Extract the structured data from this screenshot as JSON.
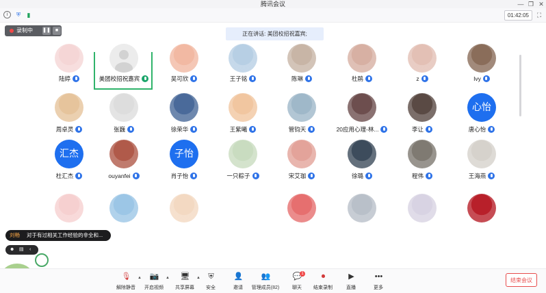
{
  "window": {
    "title": "腾讯会议",
    "minimize_glyph": "—",
    "restore_glyph": "❐",
    "close_glyph": "✕"
  },
  "topbar": {
    "timer": "01:42:05"
  },
  "recording": {
    "label": "录制中",
    "pause_glyph": "❚❚",
    "stop_glyph": "■"
  },
  "speaking": {
    "text": "正在讲话: 美团校招祝嘉宾;"
  },
  "participants": [
    {
      "name": "陆婷",
      "avatar": "photo",
      "color": "#f5d6d6",
      "mic": "blue"
    },
    {
      "name": "美团校招祝嘉宾",
      "avatar": "default",
      "color": "#eeeeee",
      "mic": "green"
    },
    {
      "name": "吴可欣",
      "avatar": "photo",
      "color": "#f2b9a3",
      "mic": "blue"
    },
    {
      "name": "王子铭",
      "avatar": "photo",
      "color": "#b7cfe4",
      "mic": "blue"
    },
    {
      "name": "陈琳",
      "avatar": "photo",
      "color": "#c8b5a6",
      "mic": "blue"
    },
    {
      "name": "杜鹃",
      "avatar": "photo",
      "color": "#d7b0a3",
      "mic": "blue"
    },
    {
      "name": "z",
      "avatar": "photo",
      "color": "#e3c0b5",
      "mic": "blue"
    },
    {
      "name": "Ivy",
      "avatar": "photo",
      "color": "#8a6d5a",
      "mic": "blue"
    },
    {
      "name": "周卓灵",
      "avatar": "photo",
      "color": "#e6c49c",
      "mic": "blue"
    },
    {
      "name": "张巍",
      "avatar": "photo",
      "color": "#dddddd",
      "mic": "blue"
    },
    {
      "name": "徐荣华",
      "avatar": "photo",
      "color": "#4a6a9a",
      "mic": "blue"
    },
    {
      "name": "王紫曦",
      "avatar": "photo",
      "color": "#f1c6a0",
      "mic": "blue"
    },
    {
      "name": "管钧天",
      "avatar": "photo",
      "color": "#9fb8c9",
      "mic": "blue"
    },
    {
      "name": "20应用心理-林...",
      "avatar": "photo",
      "color": "#6d4e4e",
      "mic": "blue"
    },
    {
      "name": "李让",
      "avatar": "photo",
      "color": "#5a4a44",
      "mic": "blue"
    },
    {
      "name": "唐心怡",
      "avatar": "text",
      "text": "心怡",
      "mic": "blue"
    },
    {
      "name": "杜汇杰",
      "avatar": "text",
      "text": "汇杰",
      "mic": "blue"
    },
    {
      "name": "ouyanfei",
      "avatar": "photo",
      "color": "#b05a4a",
      "mic": "blue"
    },
    {
      "name": "肖子怡",
      "avatar": "text",
      "text": "子怡",
      "mic": "blue"
    },
    {
      "name": "一只粽子",
      "avatar": "photo",
      "color": "#c9dcc0",
      "mic": "blue"
    },
    {
      "name": "宋艾珈",
      "avatar": "photo",
      "color": "#e3a39a",
      "mic": "blue"
    },
    {
      "name": "徐璐",
      "avatar": "photo",
      "color": "#3d4c5c",
      "mic": "blue"
    },
    {
      "name": "程伟",
      "avatar": "photo",
      "color": "#7f7a72",
      "mic": "blue"
    },
    {
      "name": "王海燕",
      "avatar": "photo",
      "color": "#d6d2cc",
      "mic": "blue"
    },
    {
      "name": "",
      "avatar": "photo",
      "color": "#f6d0d0",
      "mic": "none"
    },
    {
      "name": "",
      "avatar": "photo",
      "color": "#9cc6e6",
      "mic": "none"
    },
    {
      "name": "",
      "avatar": "photo",
      "color": "#f3d9c2",
      "mic": "none"
    },
    {
      "name": "",
      "avatar": "photo",
      "color": "#ffffff",
      "mic": "none"
    },
    {
      "name": "",
      "avatar": "photo",
      "color": "#e66f6f",
      "mic": "none"
    },
    {
      "name": "",
      "avatar": "photo",
      "color": "#b9c0c9",
      "mic": "none"
    },
    {
      "name": "",
      "avatar": "photo",
      "color": "#d8d3e3",
      "mic": "none"
    },
    {
      "name": "",
      "avatar": "photo",
      "color": "#b8202a",
      "mic": "none"
    }
  ],
  "chat": {
    "sender": "刘畅",
    "message": "对于有过相关工作经验的非全和..."
  },
  "toolbar": {
    "items": [
      {
        "label": "解除静音",
        "icon": "mic-off-icon",
        "glyph": "🎙"
      },
      {
        "label": "开启视频",
        "icon": "camera-off-icon",
        "glyph": "📷"
      },
      {
        "label": "共享屏幕",
        "icon": "share-screen-icon",
        "glyph": "🖥"
      },
      {
        "label": "安全",
        "icon": "shield-icon",
        "glyph": "⛨"
      },
      {
        "label": "邀请",
        "icon": "invite-icon",
        "glyph": "👤"
      },
      {
        "label": "管理成员(82)",
        "icon": "members-icon",
        "glyph": "👥"
      },
      {
        "label": "聊天",
        "icon": "chat-icon",
        "glyph": "💬",
        "badge": "1"
      },
      {
        "label": "结束录制",
        "icon": "stop-record-icon",
        "glyph": "⏺"
      },
      {
        "label": "直播",
        "icon": "live-icon",
        "glyph": "▶"
      },
      {
        "label": "更多",
        "icon": "more-icon",
        "glyph": "•••"
      }
    ],
    "end_meeting": "结束会议"
  },
  "colors": {
    "accent": "#2f73e8",
    "danger": "#e74c4c",
    "active_speaker": "#2fb36a"
  }
}
